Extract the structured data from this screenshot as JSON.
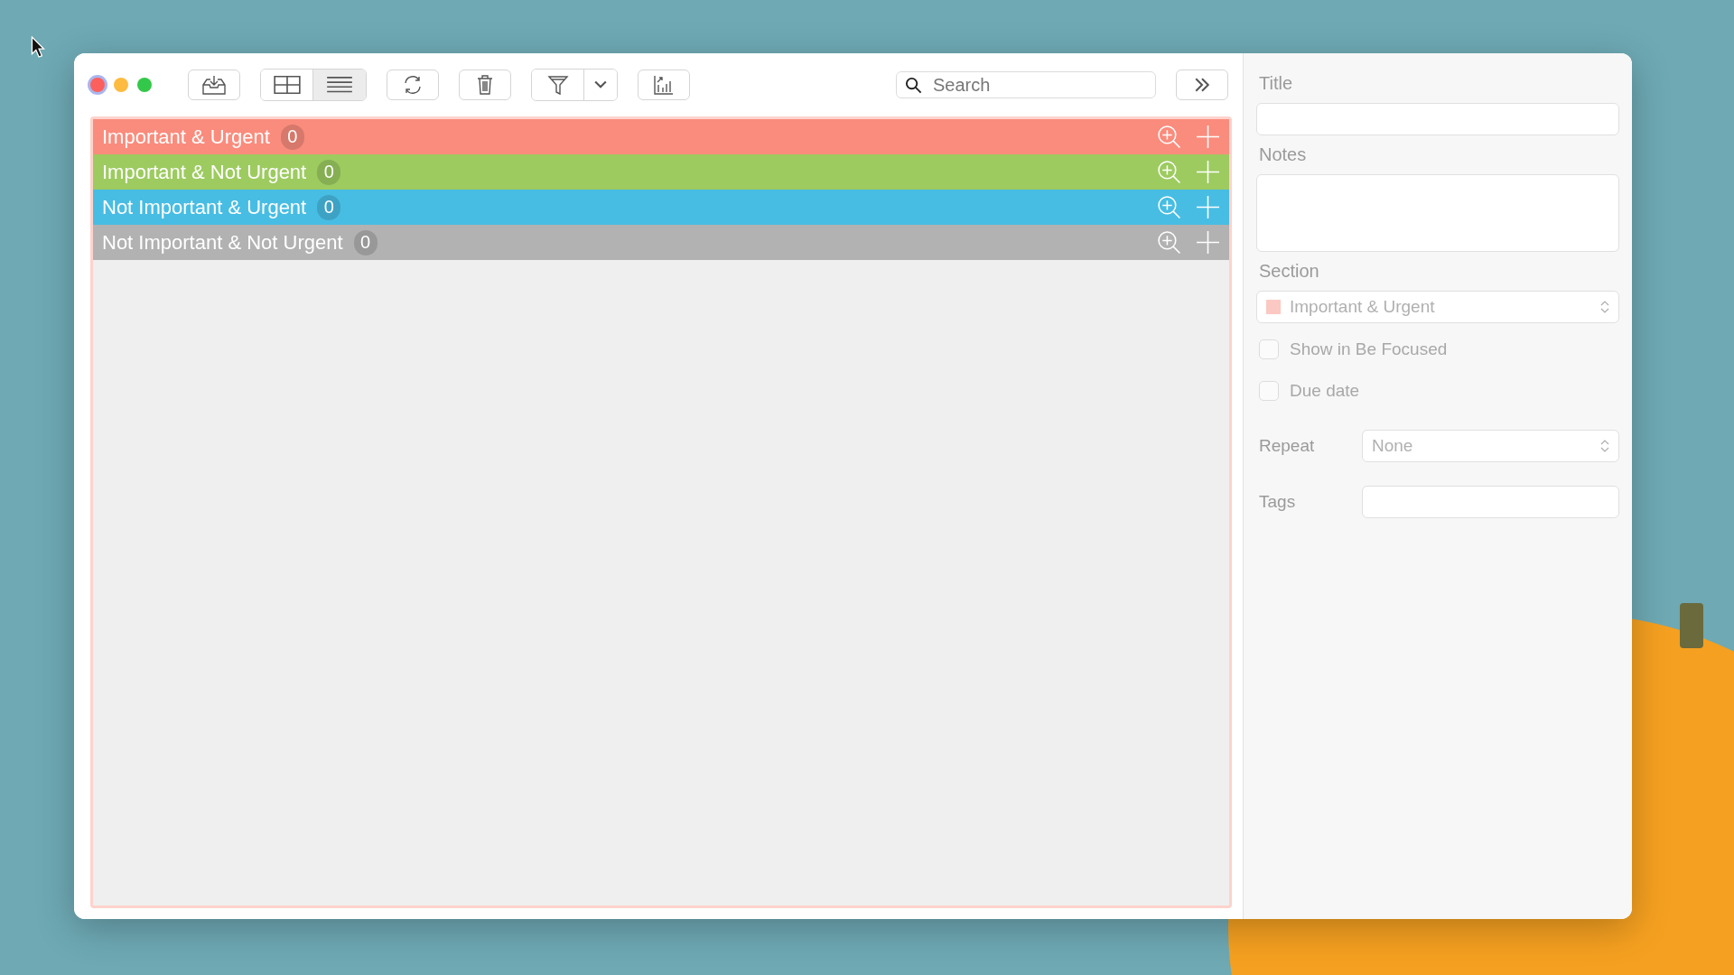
{
  "toolbar": {
    "view_toggle": [
      {
        "kind": "grid",
        "selected": false
      },
      {
        "kind": "list",
        "selected": true
      }
    ],
    "search": {
      "placeholder": "Search"
    }
  },
  "sections": [
    {
      "name": "Important & Urgent",
      "count": "0",
      "color": "#fa8c7d"
    },
    {
      "name": "Important & Not Urgent",
      "count": "0",
      "color": "#9dcb60"
    },
    {
      "name": "Not Important & Urgent",
      "count": "0",
      "color": "#48bde3"
    },
    {
      "name": "Not Important & Not Urgent",
      "count": "0",
      "color": "#b2b2b2"
    }
  ],
  "inspector": {
    "disabled": true,
    "title_label": "Title",
    "notes_label": "Notes",
    "section_label": "Section",
    "section": {
      "value": "Important & Urgent",
      "color": "#fcc8c2"
    },
    "checkboxes": [
      {
        "label": "Show in Be Focused",
        "checked": false
      },
      {
        "label": "Due date",
        "checked": false
      }
    ],
    "repeat_label": "Repeat",
    "repeat": "None",
    "tags_label": "Tags"
  }
}
